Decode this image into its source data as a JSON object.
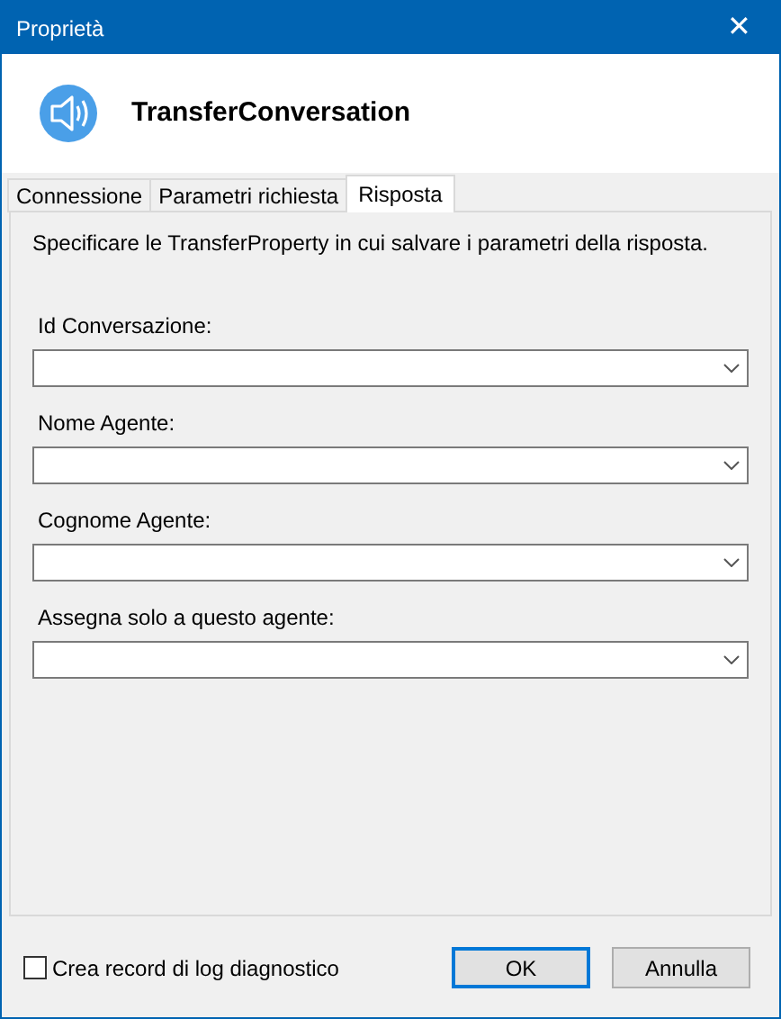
{
  "window": {
    "title": "Proprietà",
    "close": "✕"
  },
  "header": {
    "title": "TransferConversation"
  },
  "tabs": [
    {
      "label": "Connessione",
      "selected": false
    },
    {
      "label": "Parametri richiesta",
      "selected": false
    },
    {
      "label": "Risposta",
      "selected": true
    }
  ],
  "description": "Specificare le TransferProperty in cui salvare i parametri della risposta.",
  "fields": [
    {
      "label": "Id Conversazione:"
    },
    {
      "label": "Nome Agente:"
    },
    {
      "label": "Cognome Agente:"
    },
    {
      "label": "Assegna solo a questo agente:"
    }
  ],
  "diagnostic_log": {
    "label": "Crea record di log diagnostico",
    "checked": false
  },
  "buttons": [
    {
      "label": "OK",
      "default": true
    },
    {
      "label": "Annulla",
      "default": false
    }
  ]
}
